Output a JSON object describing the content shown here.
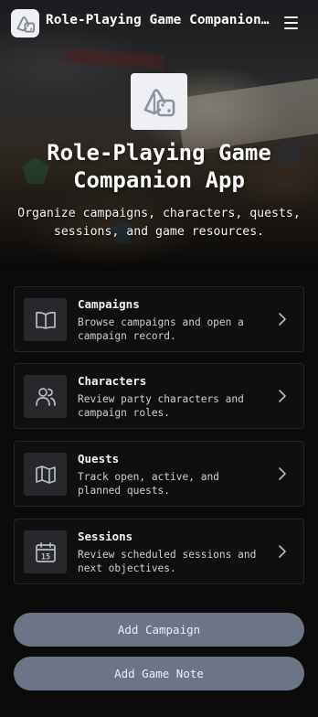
{
  "header": {
    "title": "Role-Playing Game Companion App",
    "logo_icon": "dice-icon",
    "menu_icon": "hamburger-menu-icon"
  },
  "hero": {
    "title": "Role-Playing Game Companion App",
    "subtitle": "Organize campaigns, characters, quests, sessions, and game resources."
  },
  "nav": {
    "items": [
      {
        "title": "Campaigns",
        "description": "Browse campaigns and open a campaign record.",
        "icon": "book-open-icon"
      },
      {
        "title": "Characters",
        "description": "Review party characters and campaign roles.",
        "icon": "users-icon"
      },
      {
        "title": "Quests",
        "description": "Track open, active, and planned quests.",
        "icon": "map-icon"
      },
      {
        "title": "Sessions",
        "description": "Review scheduled sessions and next objectives.",
        "icon": "calendar-icon",
        "icon_text": "15"
      }
    ]
  },
  "actions": {
    "add_campaign": "Add Campaign",
    "add_game_note": "Add Game Note"
  },
  "colors": {
    "background": "#0b0b0c",
    "card_background": "#0f0f10",
    "button": "#6c7585",
    "icon_box": "#27282b"
  }
}
